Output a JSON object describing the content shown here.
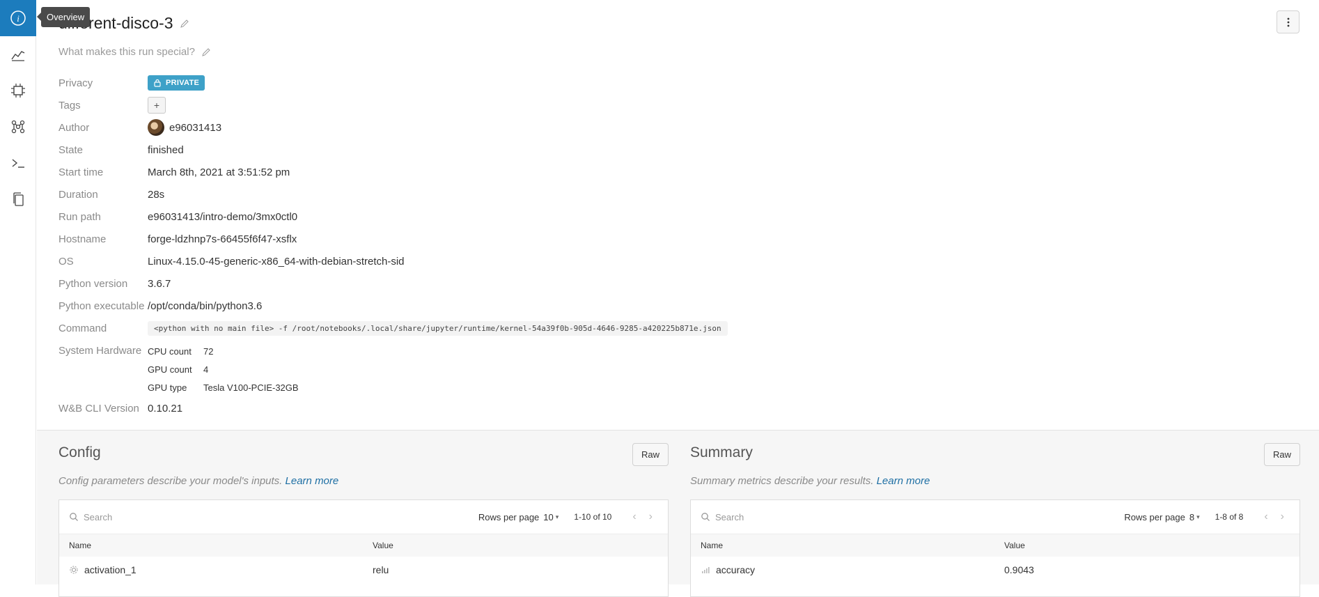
{
  "sidebar": {
    "tooltip": "Overview",
    "items": [
      {
        "name": "overview",
        "icon": "info-icon"
      },
      {
        "name": "charts",
        "icon": "line-chart-icon"
      },
      {
        "name": "system",
        "icon": "chip-icon"
      },
      {
        "name": "model",
        "icon": "model-graph-icon"
      },
      {
        "name": "logs",
        "icon": "terminal-icon"
      },
      {
        "name": "files",
        "icon": "files-icon"
      }
    ]
  },
  "header": {
    "title": "different-disco-3",
    "description_placeholder": "What makes this run special?"
  },
  "meta": {
    "privacy": {
      "label": "Privacy",
      "value": "PRIVATE"
    },
    "tags": {
      "label": "Tags",
      "button": "+"
    },
    "author": {
      "label": "Author",
      "value": "e96031413"
    },
    "state": {
      "label": "State",
      "value": "finished"
    },
    "start_time": {
      "label": "Start time",
      "value": "March 8th, 2021 at 3:51:52 pm"
    },
    "duration": {
      "label": "Duration",
      "value": "28s"
    },
    "run_path": {
      "label": "Run path",
      "value": "e96031413/intro-demo/3mx0ctl0"
    },
    "hostname": {
      "label": "Hostname",
      "value": "forge-ldzhnp7s-66455f6f47-xsflx"
    },
    "os": {
      "label": "OS",
      "value": "Linux-4.15.0-45-generic-x86_64-with-debian-stretch-sid"
    },
    "python_version": {
      "label": "Python version",
      "value": "3.6.7"
    },
    "python_executable": {
      "label": "Python executable",
      "value": "/opt/conda/bin/python3.6"
    },
    "command": {
      "label": "Command",
      "value": "<python with no main file> -f /root/notebooks/.local/share/jupyter/runtime/kernel-54a39f0b-905d-4646-9285-a420225b871e.json"
    },
    "system_hardware": {
      "label": "System Hardware",
      "rows": [
        {
          "key": "CPU count",
          "value": "72"
        },
        {
          "key": "GPU count",
          "value": "4"
        },
        {
          "key": "GPU type",
          "value": "Tesla V100-PCIE-32GB"
        }
      ]
    },
    "cli_version": {
      "label": "W&B CLI Version",
      "value": "0.10.21"
    }
  },
  "config": {
    "title": "Config",
    "raw": "Raw",
    "description": "Config parameters describe your model's inputs.",
    "learn_more": "Learn more",
    "search_placeholder": "Search",
    "rows_per_page_label": "Rows per page",
    "rows_per_page": "10",
    "range": "1-10 of 10",
    "col_name": "Name",
    "col_value": "Value",
    "rows": [
      {
        "name": "activation_1",
        "value": "relu"
      }
    ]
  },
  "summary": {
    "title": "Summary",
    "raw": "Raw",
    "description": "Summary metrics describe your results.",
    "learn_more": "Learn more",
    "search_placeholder": "Search",
    "rows_per_page_label": "Rows per page",
    "rows_per_page": "8",
    "range": "1-8 of 8",
    "col_name": "Name",
    "col_value": "Value",
    "rows": [
      {
        "name": "accuracy",
        "value": "0.9043"
      }
    ]
  },
  "colors": {
    "accent": "#1c7cbd",
    "badge": "#3ea1c8",
    "link": "#1e6fa4"
  }
}
